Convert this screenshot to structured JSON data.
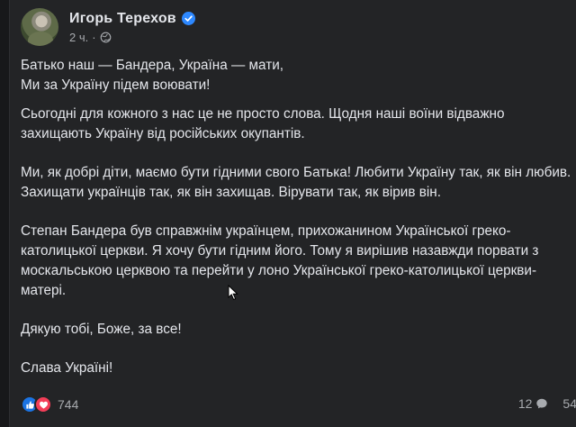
{
  "post": {
    "author": "Игорь Терехов",
    "time": "2 ч.",
    "visibility_icon": "globe-icon",
    "verified_color": "#2d88ff",
    "paragraphs": [
      "Батько наш — Бандера, Україна — мати,\nМи за Україну підем воювати!",
      "Сьогодні для кожного з нас це не просто слова. Щодня наші воїни відважно захищають Україну від російських окупантів.",
      "Ми, як добрі діти, маємо бути гідними свого Батька! Любити Україну так, як він любив. Захищати українців так, як він захищав. Вірувати так, як вірив він.",
      "Степан Бандера був справжнім українцем, прихожанином Української греко-католицької церкви. Я хочу бути гідним його. Тому я вирішив назавжди порвати з москальською церквою та перейти у лоно Української греко-католицької церкви-матері.",
      "Дякую тобі, Боже, за все!",
      "Слава Україні!"
    ]
  },
  "footer": {
    "reaction_count": "744",
    "comments_count": "12",
    "shares_count": "54",
    "like_color": "#1b74e4",
    "love_color": "#f33e58"
  }
}
